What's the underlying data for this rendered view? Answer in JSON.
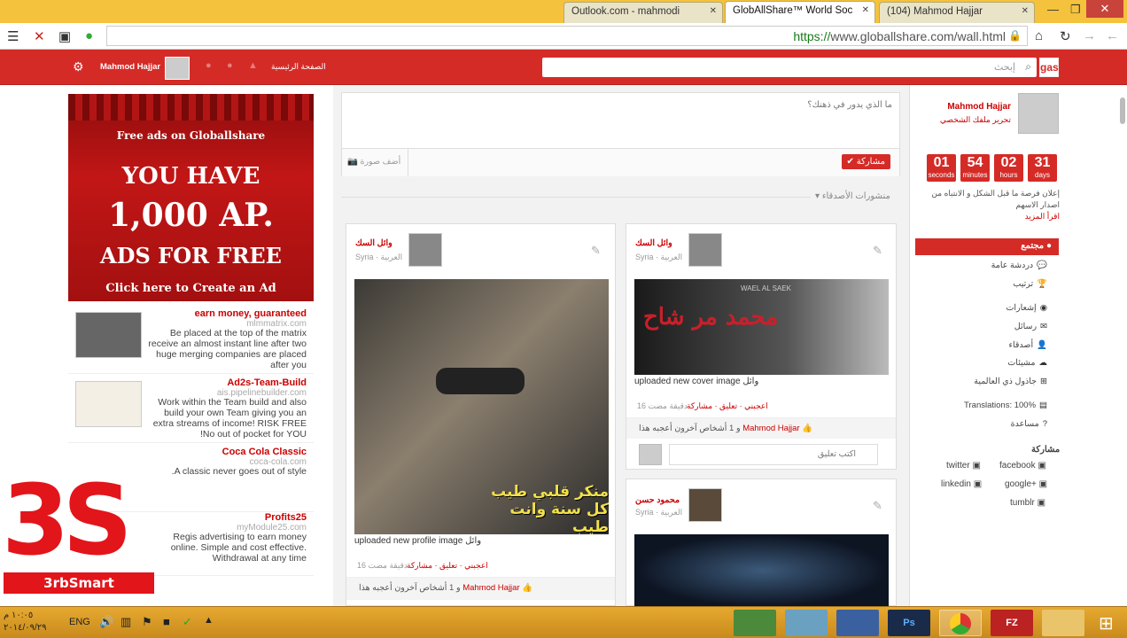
{
  "browser": {
    "tabs": [
      {
        "label": "Outlook.com - mahmodi"
      },
      {
        "label": "GlobAllShare™ World Soc"
      },
      {
        "label": "(104) Mahmod Hajjar"
      }
    ],
    "url_scheme": "https://",
    "url_rest": "www.globallshare.com/wall.html"
  },
  "header": {
    "logo": "gas",
    "search_placeholder": "إبحث",
    "home_label": "الصفحة الرئيسية",
    "user_name": "Mahmod Hajjar"
  },
  "bigad": {
    "line1": "Free ads on Globallshare",
    "line2": "YOU HAVE",
    "line3": "1,000 AP.",
    "line4": "ADS FOR FREE",
    "line5": "Click here to Create an Ad"
  },
  "ads": [
    {
      "title": "earn money, guaranteed",
      "url": "mlmmatrix.com",
      "desc": "Be placed at the top of the matrix receive an almost instant line after two huge merging companies are placed after you"
    },
    {
      "title": "Ad2s-Team-Build",
      "url": "ais.pipelinebuilder.com",
      "desc": "Work within the Team build and also build your own Team giving you an extra streams of income! RISK FREE !No out of pocket for YOU"
    },
    {
      "title": "Coca Cola Classic",
      "url": "coca-cola.com",
      "desc": ".A classic never goes out of style"
    },
    {
      "title": "Profits25",
      "url": "myModule25.com",
      "desc": "Regis advertising to earn money online. Simple and cost effective. Withdrawal at any time"
    }
  ],
  "composer": {
    "placeholder": "ما الذي يدور في ذهنك؟",
    "share_label": "مشاركة",
    "photo_label": "أضف صورة",
    "friends_posts": "منشورات الأصدقاء"
  },
  "posts": [
    {
      "name": "وائل السك",
      "sub": "Syria · العربية",
      "caption": "uploaded new profile image وائل",
      "acts": "اعجبني · تعليق · مشاركة",
      "count": "16 دقيقة مضت",
      "likes_user": "Mahmod Hajjar",
      "likes_rest": "و 1 أشخاص آخرون أعجبه هذا",
      "overlay_text": "منكر قلبي طيب كل سنة وانت طيب"
    },
    {
      "name": "وائل السك",
      "sub": "Syria · العربية",
      "caption": "uploaded new cover image وائل",
      "acts": "اعجبني · تعليق · مشاركة",
      "count": "16 دقيقة مضت",
      "likes_user": "Mahmod Hajjar",
      "likes_rest": "و 1 أشخاص آخرون أعجبه هذا",
      "comment_placeholder": "اكتب تعليق",
      "overlay_text": "محمد مر شاح",
      "overlay_small": "WAEL AL SAEK"
    },
    {
      "name": "محمود حسن",
      "sub": "Syria · العربية"
    }
  ],
  "profile": {
    "name": "Mahmod Hajjar",
    "sub": "تحرير ملفك الشخصي"
  },
  "countdown": [
    {
      "value": "01",
      "unit": "seconds"
    },
    {
      "value": "54",
      "unit": "minutes"
    },
    {
      "value": "02",
      "unit": "hours"
    },
    {
      "value": "31",
      "unit": "days"
    }
  ],
  "promo": {
    "text": "إعلان فرصة ما قبل الشكل و الانتباه من اصدار الاسهم",
    "more": "اقرأ المزيد"
  },
  "nav": {
    "active": "مجتمع",
    "items": [
      "دردشة عامة",
      "ترتيب",
      "إشعارات",
      "رسائل",
      "أصدقاء",
      "مشيئات",
      "جاذول ذي العالمية"
    ],
    "translations": "Translations: 100%",
    "help": "مساعدة"
  },
  "share": {
    "title": "مشاركة",
    "items": [
      "facebook",
      "twitter",
      "google+",
      "linkedin",
      "tumblr"
    ]
  },
  "taskbar": {
    "lang": "ENG",
    "time": "١٠:٠٥ م",
    "date": "٢٠١٤/٠٩/٢٩"
  },
  "watermark": {
    "logo": "3S",
    "label": "3rbSmart"
  }
}
